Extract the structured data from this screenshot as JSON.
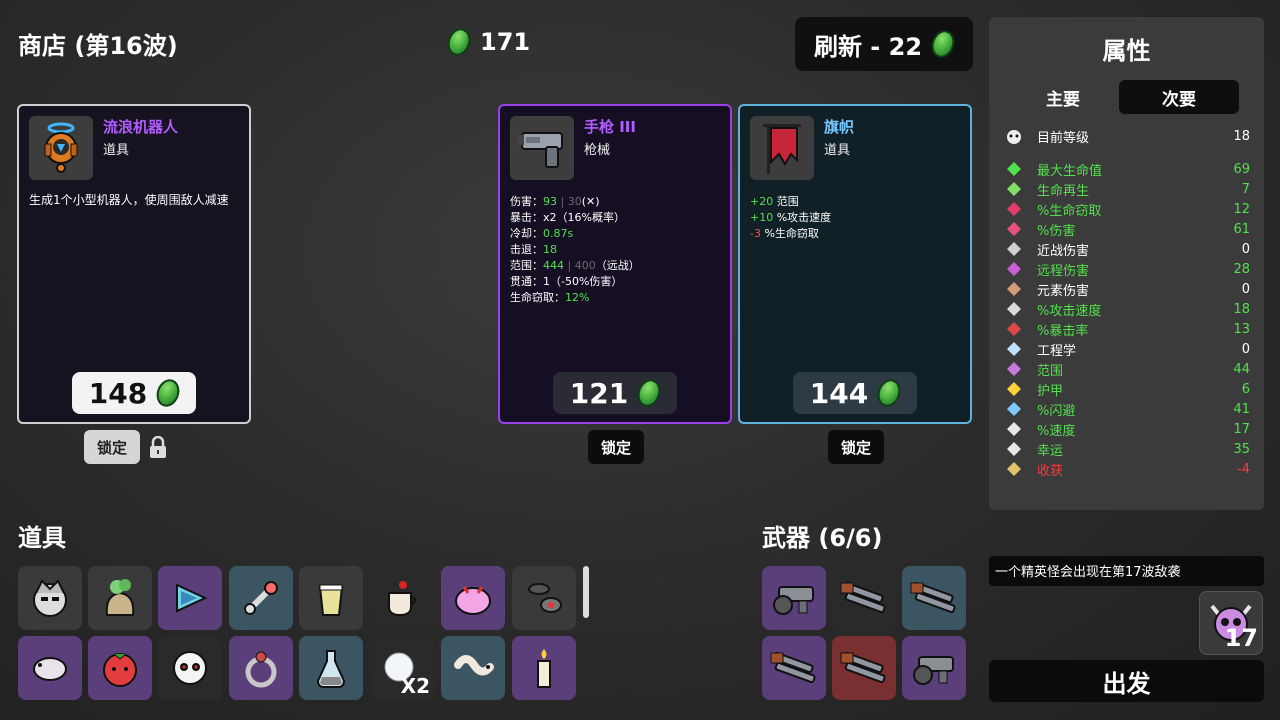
{
  "header": {
    "shop_title": "商店 (第16波)",
    "materials": "171",
    "refresh_label": "刷新 - 22"
  },
  "cards": [
    {
      "name": "流浪机器人",
      "type": "道具",
      "desc": "生成1个小型机器人，使周围敌人减速",
      "price": "148",
      "lock_label": "锁定",
      "border_color": "#cfcfcf"
    },
    {
      "name": "手枪 III",
      "type": "枪械",
      "price": "121",
      "lock_label": "锁定",
      "border_color": "#9b3fe6",
      "stats": [
        {
          "label": "伤害：",
          "value": "93",
          "extra": "| 30",
          "tail": "(✕)"
        },
        {
          "label": "暴击：",
          "value": "x2",
          "tail": "（16%概率）"
        },
        {
          "label": "冷却：",
          "value": "0.87s"
        },
        {
          "label": "击退：",
          "value": "18"
        },
        {
          "label": "范围：",
          "value": "444",
          "extra": "| 400",
          "tail": "（远战）"
        },
        {
          "label": "贯通：",
          "value": "1",
          "tail": "（-50%伤害）"
        },
        {
          "label": "生命窃取：",
          "value": "12%"
        }
      ]
    },
    {
      "name": "旗帜",
      "type": "道具",
      "price": "144",
      "lock_label": "锁定",
      "border_color": "#5fb2db",
      "stats": [
        {
          "value": "+20",
          "label": " 范围"
        },
        {
          "value": "+10",
          "label": " %攻击速度"
        },
        {
          "value": "-3",
          "label": " %生命窃取"
        }
      ]
    }
  ],
  "items_section": {
    "title": "道具",
    "x2_label": "X2"
  },
  "weapons_section": {
    "title": "武器 (6/6)"
  },
  "stats_panel": {
    "title": "属性",
    "tab_main": "主要",
    "tab_secondary": "次要",
    "level_label": "目前等级",
    "level_value": "18",
    "rows": [
      {
        "label": "最大生命值",
        "value": "69",
        "color": "#52e04c",
        "icon": "heart-icon"
      },
      {
        "label": "生命再生",
        "value": "7",
        "color": "#52e04c",
        "icon": "regen-icon"
      },
      {
        "label": "%生命窃取",
        "value": "12",
        "color": "#52e04c",
        "icon": "vampire-icon"
      },
      {
        "label": "%伤害",
        "value": "61",
        "color": "#52e04c",
        "icon": "damage-icon"
      },
      {
        "label": "近战伤害",
        "value": "0",
        "color": "#ffffff",
        "icon": "sword-icon"
      },
      {
        "label": "远程伤害",
        "value": "28",
        "color": "#52e04c",
        "icon": "bow-icon"
      },
      {
        "label": "元素伤害",
        "value": "0",
        "color": "#ffffff",
        "icon": "fire-icon"
      },
      {
        "label": "%攻击速度",
        "value": "18",
        "color": "#52e04c",
        "icon": "hourglass-icon"
      },
      {
        "label": "%暴击率",
        "value": "13",
        "color": "#52e04c",
        "icon": "crit-icon"
      },
      {
        "label": "工程学",
        "value": "0",
        "color": "#ffffff",
        "icon": "wrench-icon"
      },
      {
        "label": "范围",
        "value": "44",
        "color": "#52e04c",
        "icon": "range-icon"
      },
      {
        "label": "护甲",
        "value": "6",
        "color": "#52e04c",
        "icon": "armor-icon"
      },
      {
        "label": "%闪避",
        "value": "41",
        "color": "#52e04c",
        "icon": "dodge-icon"
      },
      {
        "label": "%速度",
        "value": "17",
        "color": "#52e04c",
        "icon": "boot-icon"
      },
      {
        "label": "幸运",
        "value": "35",
        "color": "#52e04c",
        "icon": "dice-icon"
      },
      {
        "label": "收获",
        "value": "-4",
        "color": "#ff3b3b",
        "icon": "harvest-icon"
      }
    ]
  },
  "notice": "一个精英怪会出现在第17波敌袭",
  "danger_level": "17",
  "go_label": "出发"
}
